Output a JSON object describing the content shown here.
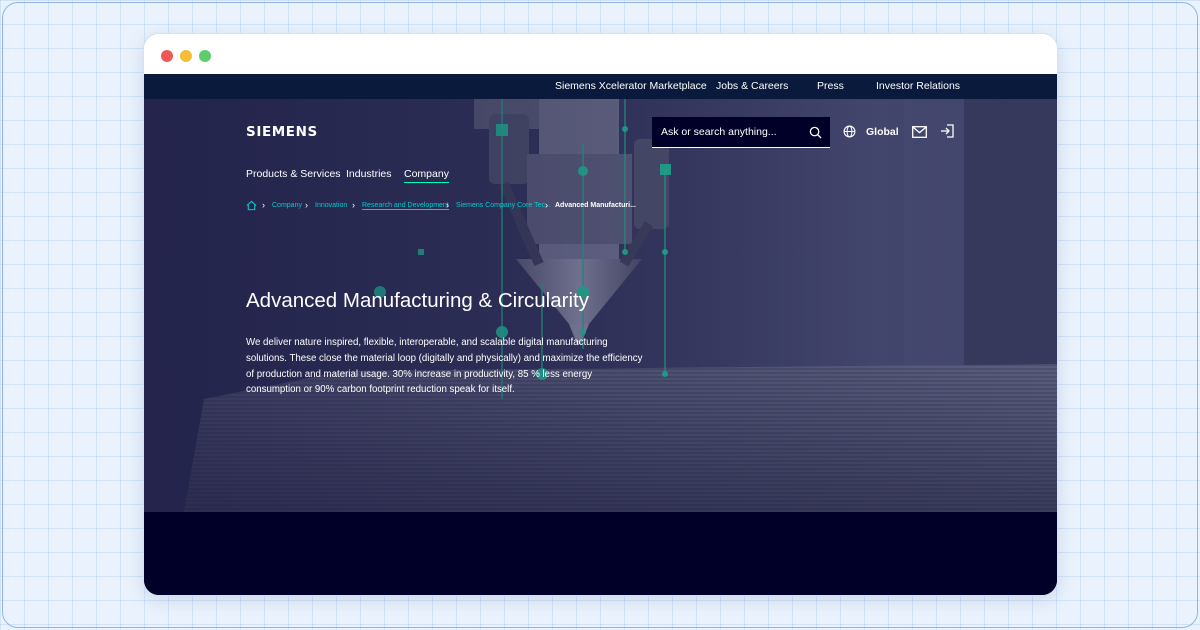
{
  "topbar": {
    "links": [
      {
        "label": "Siemens Xcelerator Marketplace"
      },
      {
        "label": "Jobs & Careers"
      },
      {
        "label": "Press"
      },
      {
        "label": "Investor Relations"
      }
    ]
  },
  "header": {
    "logo": "SIEMENS",
    "search_placeholder": "Ask or search anything...",
    "region_label": "Global"
  },
  "mainnav": {
    "items": [
      {
        "label": "Products & Services"
      },
      {
        "label": "Industries"
      },
      {
        "label": "Company",
        "active": true
      }
    ]
  },
  "breadcrumb": {
    "items": [
      {
        "label": "Company"
      },
      {
        "label": "Innovation"
      },
      {
        "label": "Research and Development"
      },
      {
        "label": "Siemens Company Core Tec..."
      },
      {
        "label": "Advanced Manufacturi..."
      }
    ]
  },
  "hero": {
    "title": "Advanced Manufacturing & Circularity",
    "text": "We deliver nature inspired, flexible, interoperable, and scalable digital manufacturing solutions. These close the material loop (digitally and physically) and maximize the efficiency of production and material usage. 30% increase in productivity, 85 % less energy consumption or 90% carbon footprint reduction speak for itself."
  },
  "colors": {
    "brand_background": "#000028",
    "accent": "#00ffb9",
    "link": "#00cccc",
    "topbar": "#0a1a3d"
  },
  "icons": [
    "home-icon",
    "search-icon",
    "globe-icon",
    "mail-icon",
    "login-icon",
    "chevron-right-icon"
  ]
}
